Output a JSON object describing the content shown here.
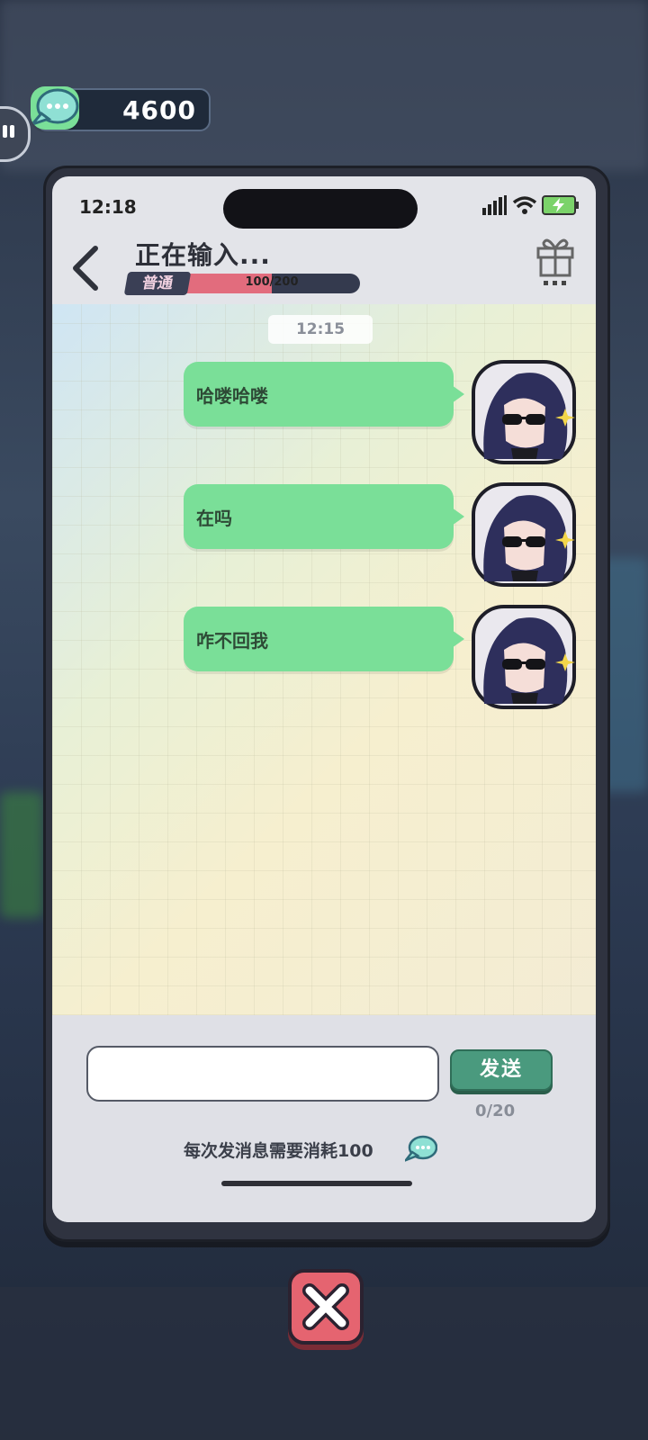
{
  "currency": {
    "amount": "4600",
    "icon": "chat-bubble-currency-icon"
  },
  "status_bar": {
    "time": "12:18"
  },
  "header": {
    "title": "正在输入...",
    "level_label": "普通",
    "affinity_text": "100/200",
    "affinity_progress": 0.5,
    "back_icon": "chevron-left-icon",
    "gift_icon": "gift-icon"
  },
  "chat": {
    "timestamp": "12:15",
    "messages": [
      {
        "text": "哈喽哈喽"
      },
      {
        "text": "在吗"
      },
      {
        "text": "咋不回我"
      }
    ]
  },
  "composer": {
    "placeholder": "",
    "send_label": "发送",
    "counter": "0/20",
    "cost_note": "每次发消息需要消耗100"
  },
  "colors": {
    "bubble": "#7adf98",
    "send": "#4a9a7e",
    "close": "#e56470"
  }
}
